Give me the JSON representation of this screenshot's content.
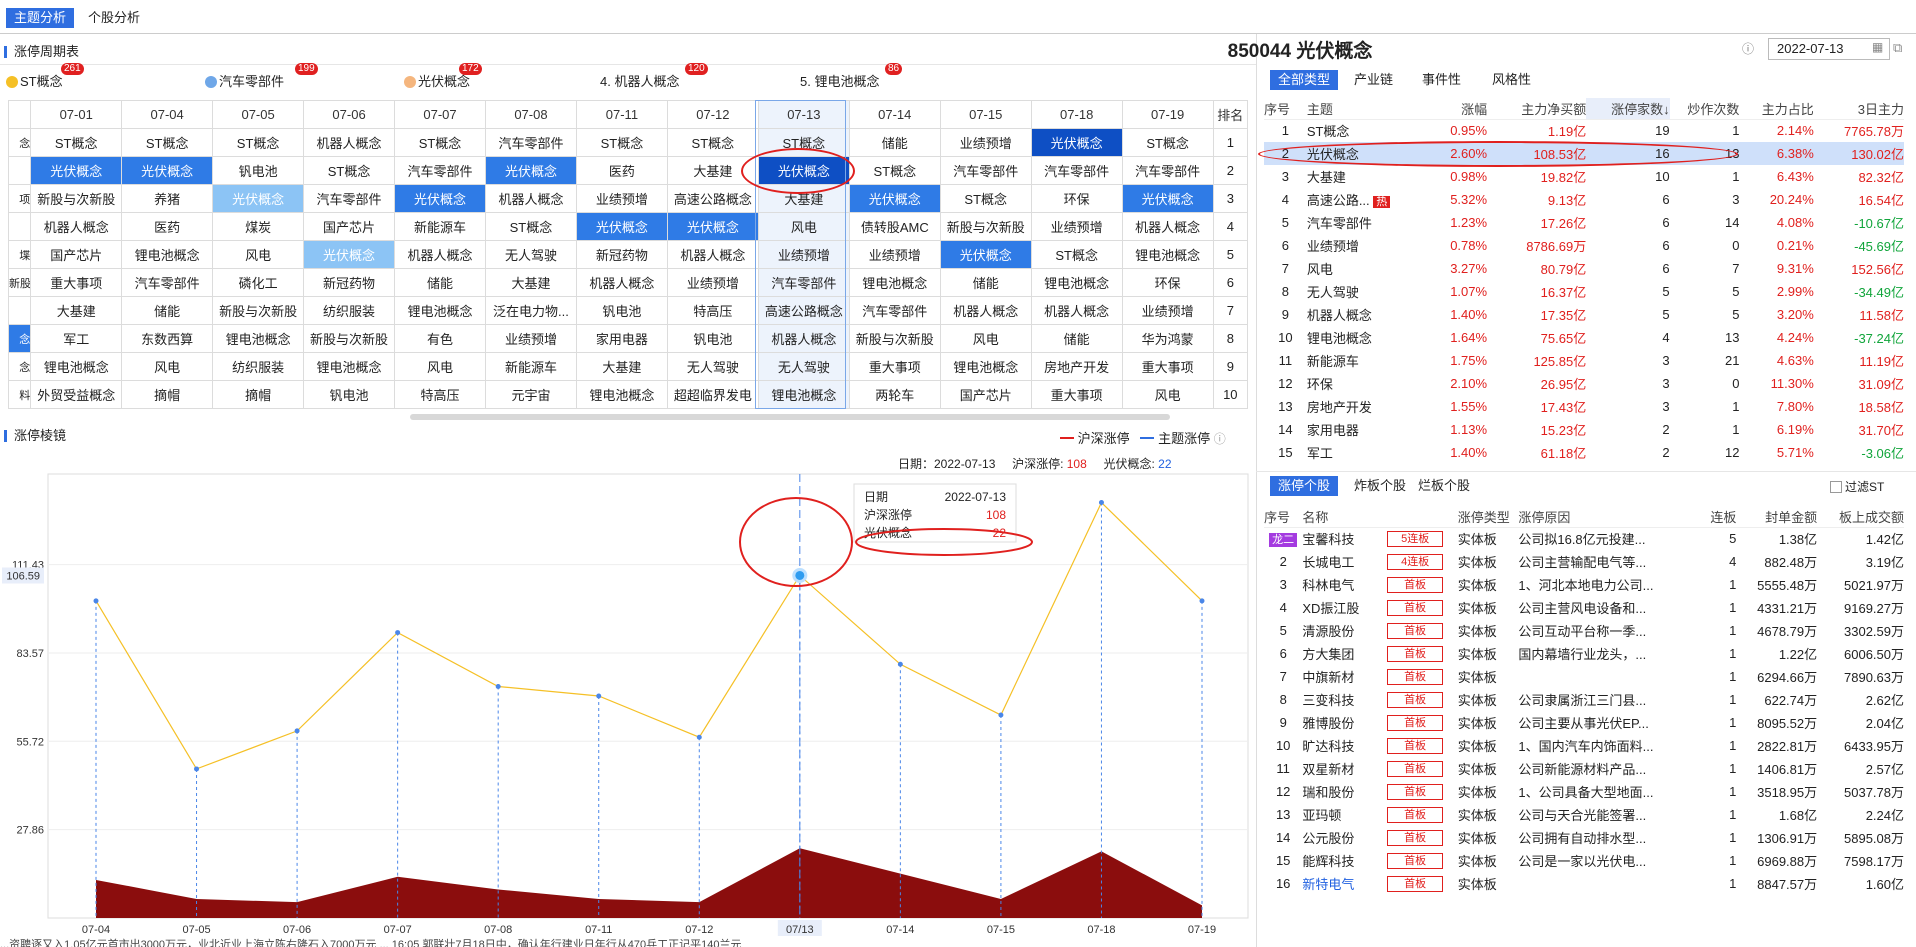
{
  "nav": {
    "tabs": [
      "主题分析",
      "个股分析"
    ]
  },
  "cycle": {
    "title": "涨停周期表",
    "legend": [
      {
        "label": "ST概念",
        "count": "261",
        "color": "#f5c026"
      },
      {
        "label": "汽车零部件",
        "count": "199",
        "color": "#6fa7e8"
      },
      {
        "label": "光伏概念",
        "count": "172",
        "color": "#f5b67e"
      },
      {
        "label": "4. 机器人概念",
        "count": "120",
        "color": ""
      },
      {
        "label": "5. 锂电池概念",
        "count": "86",
        "color": ""
      }
    ],
    "dates": [
      "07-01",
      "07-04",
      "07-05",
      "07-06",
      "07-07",
      "07-08",
      "07-11",
      "07-12",
      "07-13",
      "07-14",
      "07-15",
      "07-18",
      "07-19"
    ],
    "rank_header": "排名",
    "left_frag": [
      "念",
      "",
      "项",
      "",
      "堞",
      "新股",
      "",
      "念",
      "念",
      "料"
    ],
    "rows": [
      [
        "ST概念",
        "ST概念",
        "ST概念",
        "机器人概念",
        "ST概念",
        "汽车零部件",
        "ST概念",
        "ST概念",
        "ST概念",
        "储能",
        "业绩预增",
        "光伏概念",
        "ST概念"
      ],
      [
        "光伏概念",
        "光伏概念",
        "钒电池",
        "ST概念",
        "汽车零部件",
        "光伏概念",
        "医药",
        "大基建",
        "光伏概念",
        "ST概念",
        "汽车零部件",
        "汽车零部件",
        "汽车零部件"
      ],
      [
        "新股与次新股",
        "养猪",
        "光伏概念",
        "汽车零部件",
        "光伏概念",
        "机器人概念",
        "业绩预增",
        "高速公路概念",
        "大基建",
        "光伏概念",
        "ST概念",
        "环保",
        "光伏概念"
      ],
      [
        "机器人概念",
        "医药",
        "煤炭",
        "国产芯片",
        "新能源车",
        "ST概念",
        "光伏概念",
        "光伏概念",
        "风电",
        "债转股AMC",
        "新股与次新股",
        "业绩预增",
        "机器人概念"
      ],
      [
        "国产芯片",
        "锂电池概念",
        "风电",
        "光伏概念",
        "机器人概念",
        "无人驾驶",
        "新冠药物",
        "机器人概念",
        "业绩预增",
        "业绩预增",
        "光伏概念",
        "ST概念",
        "锂电池概念"
      ],
      [
        "重大事项",
        "汽车零部件",
        "磷化工",
        "新冠药物",
        "储能",
        "大基建",
        "机器人概念",
        "业绩预增",
        "汽车零部件",
        "锂电池概念",
        "储能",
        "锂电池概念",
        "环保"
      ],
      [
        "大基建",
        "储能",
        "新股与次新股",
        "纺织服装",
        "锂电池概念",
        "泛在电力物...",
        "钒电池",
        "特高压",
        "高速公路概念",
        "汽车零部件",
        "机器人概念",
        "机器人概念",
        "业绩预增"
      ],
      [
        "军工",
        "东数西算",
        "锂电池概念",
        "新股与次新股",
        "有色",
        "业绩预增",
        "家用电器",
        "钒电池",
        "机器人概念",
        "新股与次新股",
        "风电",
        "储能",
        "华为鸿蒙"
      ],
      [
        "锂电池概念",
        "风电",
        "纺织服装",
        "锂电池概念",
        "风电",
        "新能源车",
        "大基建",
        "无人驾驶",
        "无人驾驶",
        "重大事项",
        "锂电池概念",
        "房地产开发",
        "重大事项"
      ],
      [
        "外贸受益概念",
        "摘帽",
        "摘帽",
        "钒电池",
        "特高压",
        "元宇宙",
        "锂电池概念",
        "超超临界发电",
        "锂电池概念",
        "两轮车",
        "国产芯片",
        "重大事项",
        "风电"
      ]
    ],
    "ranks": [
      "1",
      "2",
      "3",
      "4",
      "5",
      "6",
      "7",
      "8",
      "9",
      "10"
    ]
  },
  "sector": {
    "title": "850044 光伏概念",
    "date": "2022-07-13",
    "tabs": [
      "全部类型",
      "产业链",
      "事件性",
      "风格性"
    ],
    "headers": [
      "序号",
      "主题",
      "涨幅",
      "主力净买额",
      "涨停家数↓",
      "炒作次数",
      "主力占比",
      "3日主力"
    ],
    "rows": [
      [
        "1",
        "ST概念",
        "0.95%",
        "1.19亿",
        "19",
        "1",
        "2.14%",
        "7765.78万"
      ],
      [
        "2",
        "光伏概念",
        "2.60%",
        "108.53亿",
        "16",
        "13",
        "6.38%",
        "130.02亿"
      ],
      [
        "3",
        "大基建",
        "0.98%",
        "19.82亿",
        "10",
        "1",
        "6.43%",
        "82.32亿"
      ],
      [
        "4",
        "高速公路...",
        "5.32%",
        "9.13亿",
        "6",
        "3",
        "20.24%",
        "16.54亿"
      ],
      [
        "5",
        "汽车零部件",
        "1.23%",
        "17.26亿",
        "6",
        "14",
        "4.08%",
        "-10.67亿"
      ],
      [
        "6",
        "业绩预增",
        "0.78%",
        "8786.69万",
        "6",
        "0",
        "0.21%",
        "-45.69亿"
      ],
      [
        "7",
        "风电",
        "3.27%",
        "80.79亿",
        "6",
        "7",
        "9.31%",
        "152.56亿"
      ],
      [
        "8",
        "无人驾驶",
        "1.07%",
        "16.37亿",
        "5",
        "5",
        "2.99%",
        "-34.49亿"
      ],
      [
        "9",
        "机器人概念",
        "1.40%",
        "17.35亿",
        "5",
        "5",
        "3.20%",
        "11.58亿"
      ],
      [
        "10",
        "锂电池概念",
        "1.64%",
        "75.65亿",
        "4",
        "13",
        "4.24%",
        "-37.24亿"
      ],
      [
        "11",
        "新能源车",
        "1.75%",
        "125.85亿",
        "3",
        "21",
        "4.63%",
        "11.19亿"
      ],
      [
        "12",
        "环保",
        "2.10%",
        "26.95亿",
        "3",
        "0",
        "11.30%",
        "31.09亿"
      ],
      [
        "13",
        "房地产开发",
        "1.55%",
        "17.43亿",
        "3",
        "1",
        "7.80%",
        "18.58亿"
      ],
      [
        "14",
        "家用电器",
        "1.13%",
        "15.23亿",
        "2",
        "1",
        "6.19%",
        "31.70亿"
      ],
      [
        "15",
        "军工",
        "1.40%",
        "61.18亿",
        "2",
        "12",
        "5.71%",
        "-3.06亿"
      ]
    ],
    "hot_badge": "热"
  },
  "stocks": {
    "tabs": [
      "涨停个股",
      "炸板个股",
      "烂板个股"
    ],
    "filter_label": "过滤ST",
    "headers": [
      "序号",
      "名称",
      "",
      "涨停类型",
      "涨停原因",
      "连板",
      "封单金额",
      "板上成交额"
    ],
    "rows": [
      [
        "龙二",
        "宝馨科技",
        "5连板",
        "实体板",
        "公司拟16.8亿元投建...",
        "5",
        "1.38亿",
        "1.42亿"
      ],
      [
        "2",
        "长城电工",
        "4连板",
        "实体板",
        "公司主营输配电气等...",
        "4",
        "882.48万",
        "3.19亿"
      ],
      [
        "3",
        "科林电气",
        "首板",
        "实体板",
        "1、河北本地电力公司...",
        "1",
        "5555.48万",
        "5021.97万"
      ],
      [
        "4",
        "XD振江股",
        "首板",
        "实体板",
        "公司主营风电设备和...",
        "1",
        "4331.21万",
        "9169.27万"
      ],
      [
        "5",
        "清源股份",
        "首板",
        "实体板",
        "公司互动平台称一季...",
        "1",
        "4678.79万",
        "3302.59万"
      ],
      [
        "6",
        "方大集团",
        "首板",
        "实体板",
        "国内幕墙行业龙头，...",
        "1",
        "1.22亿",
        "6006.50万"
      ],
      [
        "7",
        "中旗新材",
        "首板",
        "实体板",
        "",
        "1",
        "6294.66万",
        "7890.63万"
      ],
      [
        "8",
        "三变科技",
        "首板",
        "实体板",
        "公司隶属浙江三门县...",
        "1",
        "622.74万",
        "2.62亿"
      ],
      [
        "9",
        "雅博股份",
        "首板",
        "实体板",
        "公司主要从事光伏EP...",
        "1",
        "8095.52万",
        "2.04亿"
      ],
      [
        "10",
        "旷达科技",
        "首板",
        "实体板",
        "1、国内汽车内饰面料...",
        "1",
        "2822.81万",
        "6433.95万"
      ],
      [
        "11",
        "双星新材",
        "首板",
        "实体板",
        "公司新能源材料产品...",
        "1",
        "1406.81万",
        "2.57亿"
      ],
      [
        "12",
        "瑞和股份",
        "首板",
        "实体板",
        "1、公司具备大型地面...",
        "1",
        "3518.95万",
        "5037.78万"
      ],
      [
        "13",
        "亚玛顿",
        "首板",
        "实体板",
        "公司与天合光能签署...",
        "1",
        "1.68亿",
        "2.24亿"
      ],
      [
        "14",
        "公元股份",
        "首板",
        "实体板",
        "公司拥有自动排水型...",
        "1",
        "1306.91万",
        "5895.08万"
      ],
      [
        "15",
        "能辉科技",
        "首板",
        "实体板",
        "公司是一家以光伏电...",
        "1",
        "6969.88万",
        "7598.17万"
      ],
      [
        "16",
        "新特电气",
        "首板",
        "实体板",
        "",
        "1",
        "8847.57万",
        "1.60亿"
      ]
    ]
  },
  "mirror": {
    "title": "涨停棱镜",
    "legend_a": "沪深涨停",
    "legend_b": "主题涨停",
    "info_date_label": "日期：2022-07-13",
    "info_a_label": "沪深涨停:",
    "info_a_val": "108",
    "info_b_label": "光伏概念:",
    "info_b_val": "22",
    "tip": {
      "date_label": "日期",
      "date_val": "2022-07-13",
      "a_label": "沪深涨停",
      "a_val": "108",
      "b_label": "光伏概念",
      "b_val": "22"
    },
    "cursor_label": "106.59",
    "selected_x": "07/13"
  },
  "chart_data": {
    "type": "line",
    "x": [
      "07-04",
      "07-05",
      "07-06",
      "07-07",
      "07-08",
      "07-11",
      "07-12",
      "07/13",
      "07-14",
      "07-15",
      "07-18",
      "07-19"
    ],
    "yticks": [
      "111.43",
      "83.57",
      "55.72",
      "27.86"
    ],
    "series": [
      {
        "name": "沪深涨停",
        "values": [
          100,
          47,
          59,
          90,
          73,
          70,
          57,
          108,
          80,
          64,
          131,
          100
        ],
        "color": "#f5c026"
      },
      {
        "name": "光伏概念",
        "values": [
          12,
          6,
          5,
          13,
          9,
          6,
          5,
          22,
          14,
          6,
          21,
          4
        ],
        "color": "#8b0d0d"
      }
    ],
    "ylim": [
      0,
      140
    ]
  },
  "status_bar": "...资聘逐又入1.05亿元首市出3000万元，业北近业上海立陈右隆石入7000万元 ... 16:05 郭联壮7月18日中，确认年行建业日年行从470兵工正记平140兰元"
}
